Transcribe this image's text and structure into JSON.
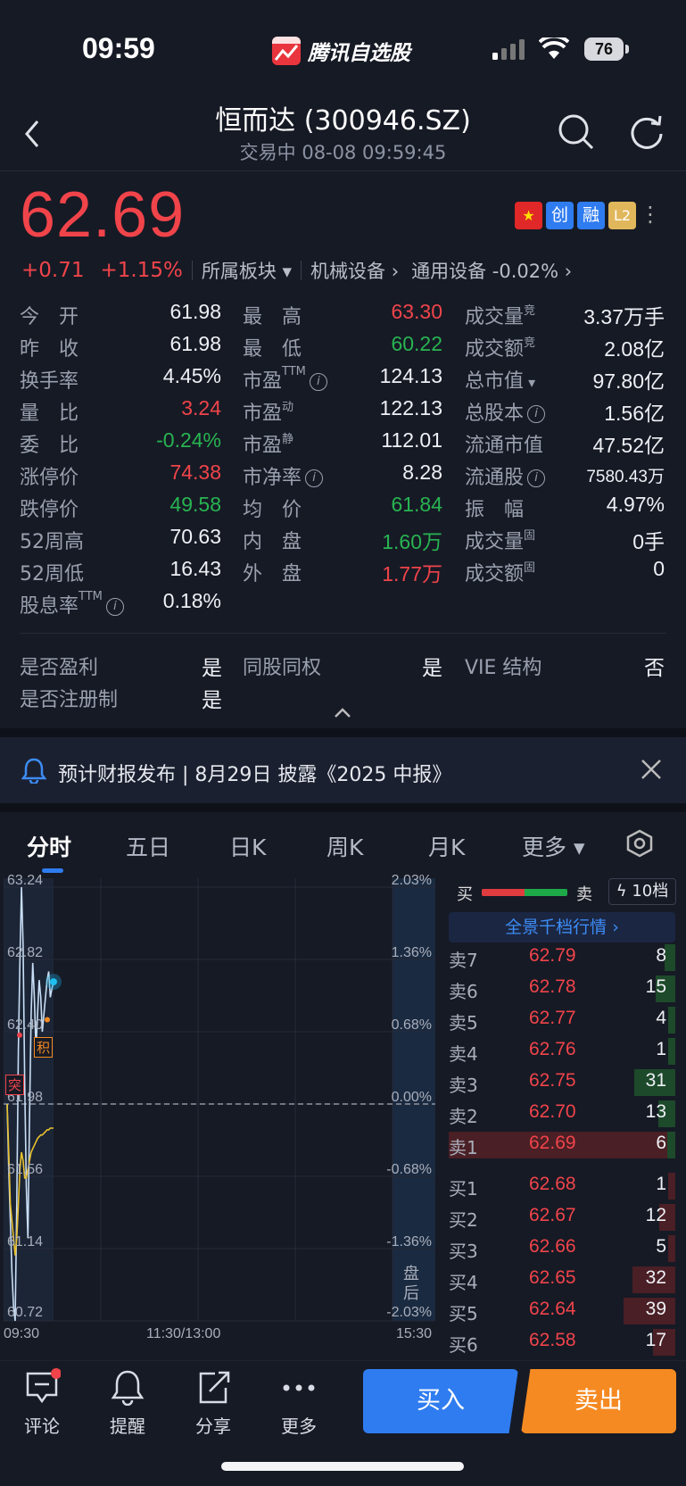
{
  "status_bar": {
    "time": "09:59",
    "app_name": "腾讯自选股",
    "battery": "76"
  },
  "header": {
    "title": "恒而达 (300946.SZ)",
    "trade_status": "交易中   08-08 09:59:45"
  },
  "price": {
    "last": "62.69",
    "change_abs": "+0.71",
    "change_pct": "+1.15%",
    "sector_label": "所属板块",
    "sector_1": "机械设备",
    "sector_2": "通用设备 -0.02%"
  },
  "badges": {
    "cn": "★",
    "chuang": "创",
    "rong": "融",
    "l2": "L2"
  },
  "quote": {
    "col1": [
      {
        "label": "今　开",
        "value": "61.98",
        "color": "white"
      },
      {
        "label": "昨　收",
        "value": "61.98",
        "color": "white"
      },
      {
        "label": "换手率",
        "value": "4.45%",
        "color": "white"
      },
      {
        "label": "量　比",
        "value": "3.24",
        "color": "red"
      },
      {
        "label": "委　比",
        "value": "-0.24%",
        "color": "green"
      },
      {
        "label": "涨停价",
        "value": "74.38",
        "color": "red"
      },
      {
        "label": "跌停价",
        "value": "49.58",
        "color": "green"
      },
      {
        "label": "52周高",
        "value": "70.63",
        "color": "white"
      },
      {
        "label": "52周低",
        "value": "16.43",
        "color": "white"
      },
      {
        "label": "股息率",
        "sup": "TTM",
        "info": true,
        "value": "0.18%",
        "color": "white"
      }
    ],
    "col2": [
      {
        "label": "最　高",
        "value": "63.30",
        "color": "red"
      },
      {
        "label": "最　低",
        "value": "60.22",
        "color": "green"
      },
      {
        "label": "市盈",
        "sup": "TTM",
        "info": true,
        "value": "124.13",
        "color": "white"
      },
      {
        "label": "市盈",
        "sup": "动",
        "value": "122.13",
        "color": "white"
      },
      {
        "label": "市盈",
        "sup": "静",
        "value": "112.01",
        "color": "white"
      },
      {
        "label": "市净率",
        "info": true,
        "value": "8.28",
        "color": "white"
      },
      {
        "label": "均　价",
        "value": "61.84",
        "color": "green"
      },
      {
        "label": "内　盘",
        "value": "1.60万",
        "color": "green"
      },
      {
        "label": "外　盘",
        "value": "1.77万",
        "color": "red"
      }
    ],
    "col3": [
      {
        "label": "成交量",
        "sup": "竞",
        "value": "3.37万手",
        "color": "white"
      },
      {
        "label": "成交额",
        "sup": "竞",
        "value": "2.08亿",
        "color": "white"
      },
      {
        "label": "总市值",
        "caret": true,
        "value": "97.80亿",
        "color": "white"
      },
      {
        "label": "总股本",
        "info": true,
        "value": "1.56亿",
        "color": "white"
      },
      {
        "label": "流通市值",
        "value": "47.52亿",
        "color": "white"
      },
      {
        "label": "流通股",
        "info": true,
        "value": "7580.43万",
        "color": "white"
      },
      {
        "label": "振　幅",
        "value": "4.97%",
        "color": "white"
      },
      {
        "label": "成交量",
        "sup": "固",
        "value": "0手",
        "color": "white"
      },
      {
        "label": "成交额",
        "sup": "固",
        "value": "0",
        "color": "white"
      }
    ],
    "flags": [
      {
        "label": "是否盈利",
        "value": "是"
      },
      {
        "label": "同股同权",
        "value": "是"
      },
      {
        "label": "VIE 结构",
        "value": "否"
      },
      {
        "label": "是否注册制",
        "value": "是"
      }
    ]
  },
  "notice": {
    "text": "预计财报发布 | 8月29日 披露《2025 中报》"
  },
  "tabs": [
    "分时",
    "五日",
    "日K",
    "周K",
    "月K",
    "更多"
  ],
  "chart": {
    "y_left": [
      "63.24",
      "62.82",
      "62.40",
      "61.98",
      "61.56",
      "61.14",
      "60.72"
    ],
    "y_right": [
      "2.03%",
      "1.36%",
      "0.68%",
      "0.00%",
      "-0.68%",
      "-1.36%",
      "-2.03%"
    ],
    "x_labels": [
      "09:30",
      "11:30/13:00",
      "15:30"
    ],
    "after_hours": "盘后",
    "marker_tu": "突",
    "marker_ji": "积",
    "prev_close": 61.98
  },
  "chart_data": {
    "type": "line",
    "x": [
      "09:30",
      "09:31",
      "09:32",
      "09:33",
      "09:34",
      "09:35",
      "09:36",
      "09:37",
      "09:38",
      "09:39",
      "09:40",
      "09:41",
      "09:42",
      "09:43",
      "09:44",
      "09:45",
      "09:46",
      "09:47",
      "09:48",
      "09:49",
      "09:50",
      "09:51",
      "09:52",
      "09:53",
      "09:54",
      "09:55",
      "09:56",
      "09:57",
      "09:58",
      "09:59"
    ],
    "series": [
      {
        "values": [
          61.98,
          61.6,
          61.3,
          61.0,
          60.8,
          60.72,
          61.4,
          62.3,
          62.8,
          63.24,
          62.9,
          62.1,
          61.5,
          61.2,
          61.9,
          62.5,
          62.8,
          62.6,
          62.3,
          62.5,
          62.7,
          62.6,
          62.4,
          62.5,
          62.6,
          62.7,
          62.75,
          62.6,
          62.65,
          62.69
        ]
      },
      {
        "values": [
          61.98,
          61.7,
          61.4,
          61.3,
          61.2,
          61.1,
          61.2,
          61.4,
          61.6,
          61.7,
          61.65,
          61.55,
          61.55,
          61.6,
          61.65,
          61.7,
          61.72,
          61.74,
          61.76,
          61.78,
          61.79,
          61.8,
          61.8,
          61.81,
          61.82,
          61.83,
          61.83,
          61.84,
          61.84,
          61.84
        ]
      }
    ],
    "ylim": [
      60.72,
      63.24
    ]
  },
  "orderbook": {
    "sell_label": "卖",
    "buy_label": "买",
    "levels_label": "10档",
    "full_label": "全景千档行情 ›",
    "asks": [
      {
        "label": "卖7",
        "price": "62.79",
        "vol": "8"
      },
      {
        "label": "卖6",
        "price": "62.78",
        "vol": "15"
      },
      {
        "label": "卖5",
        "price": "62.77",
        "vol": "4"
      },
      {
        "label": "卖4",
        "price": "62.76",
        "vol": "1"
      },
      {
        "label": "卖3",
        "price": "62.75",
        "vol": "31"
      },
      {
        "label": "卖2",
        "price": "62.70",
        "vol": "13"
      },
      {
        "label": "卖1",
        "price": "62.69",
        "vol": "6"
      }
    ],
    "bids": [
      {
        "label": "买1",
        "price": "62.68",
        "vol": "1"
      },
      {
        "label": "买2",
        "price": "62.67",
        "vol": "12"
      },
      {
        "label": "买3",
        "price": "62.66",
        "vol": "5"
      },
      {
        "label": "买4",
        "price": "62.65",
        "vol": "32"
      },
      {
        "label": "买5",
        "price": "62.64",
        "vol": "39"
      },
      {
        "label": "买6",
        "price": "62.58",
        "vol": "17"
      }
    ]
  },
  "bottom_bar": {
    "comment": "评论",
    "alert": "提醒",
    "share": "分享",
    "more": "更多",
    "buy": "买入",
    "sell": "卖出"
  },
  "colors": {
    "up": "#f0444a",
    "down": "#28b451",
    "accent": "#2f7cf0",
    "sell_btn": "#f58a22"
  }
}
